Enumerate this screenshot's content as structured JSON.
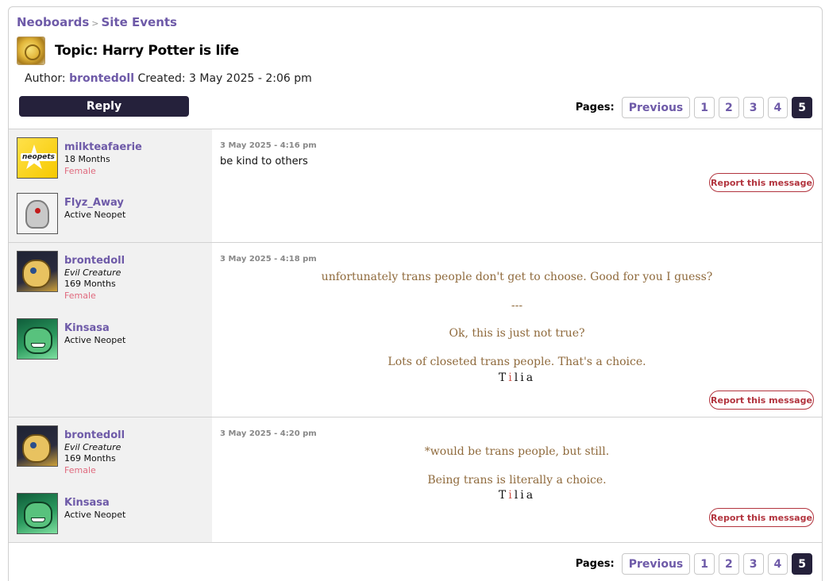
{
  "breadcrumb": {
    "root": "Neoboards",
    "separator": ">",
    "current": "Site Events"
  },
  "topic": {
    "title": "Topic: Harry Potter is life",
    "icon": "gold-coin-icon"
  },
  "meta": {
    "author_label": "Author:",
    "author": "brontedoll",
    "created_label": "Created:",
    "created": "3 May 2025 - 2:06 pm"
  },
  "reply_label": "Reply",
  "pager": {
    "label": "Pages:",
    "previous": "Previous",
    "pages": [
      "1",
      "2",
      "3",
      "4",
      "5"
    ],
    "current": "5"
  },
  "report_label": "Report this message",
  "posts": [
    {
      "author": {
        "name": "milkteafaerie",
        "line1": "18 Months",
        "gender": "Female",
        "avatar": "neopets-star-avatar"
      },
      "pet": {
        "name": "Flyz_Away",
        "status": "Active Neopet",
        "avatar": "flyz-pet-avatar"
      },
      "time": "3 May 2025 - 4:16 pm",
      "message": "be kind to others"
    },
    {
      "author": {
        "name": "brontedoll",
        "title": "Evil Creature",
        "line1": "169 Months",
        "gender": "Female",
        "avatar": "brontedoll-avatar"
      },
      "pet": {
        "name": "Kinsasa",
        "status": "Active Neopet",
        "avatar": "kinsasa-pet-avatar"
      },
      "time": "3 May 2025 - 4:18 pm",
      "lines": [
        "unfortunately trans people don't get to choose. Good for you I guess?",
        "---",
        "Ok, this is just not true?",
        "Lots of closeted trans people. That's a choice."
      ],
      "signature": [
        "T",
        "i",
        "l",
        "i",
        "a"
      ]
    },
    {
      "author": {
        "name": "brontedoll",
        "title": "Evil Creature",
        "line1": "169 Months",
        "gender": "Female",
        "avatar": "brontedoll-avatar"
      },
      "pet": {
        "name": "Kinsasa",
        "status": "Active Neopet",
        "avatar": "kinsasa-pet-avatar"
      },
      "time": "3 May 2025 - 4:20 pm",
      "lines": [
        "*would be trans people, but still.",
        "Being trans is literally a choice."
      ],
      "signature": [
        "T",
        "i",
        "l",
        "i",
        "a"
      ]
    }
  ],
  "colors": {
    "accent": "#6e5aa8",
    "dark": "#25213b",
    "report": "#b2343e",
    "gender": "#e06a7e",
    "quote": "#8f6a3c"
  }
}
